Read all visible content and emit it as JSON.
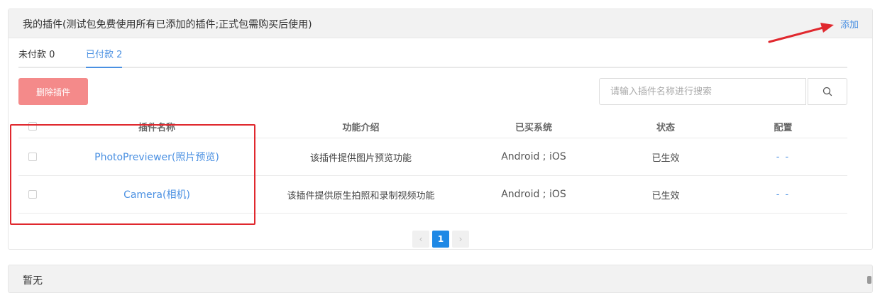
{
  "panel": {
    "title": "我的插件(测试包免费使用所有已添加的插件;正式包需购买后使用)",
    "add_label": "添加"
  },
  "tabs": {
    "unpaid": "未付款 0",
    "paid": "已付款 2"
  },
  "toolbar": {
    "delete_label": "删除插件",
    "search_placeholder": "请输入插件名称进行搜索"
  },
  "table": {
    "headers": {
      "name": "插件名称",
      "desc": "功能介绍",
      "system": "已买系统",
      "status": "状态",
      "config": "配置"
    },
    "rows": [
      {
        "name": "PhotoPreviewer(照片预览)",
        "desc": "该插件提供图片预览功能",
        "system": "Android ; iOS",
        "status": "已生效",
        "config": "- -"
      },
      {
        "name": "Camera(相机)",
        "desc": "该插件提供原生拍照和录制视频功能",
        "system": "Android ; iOS",
        "status": "已生效",
        "config": "- -"
      }
    ]
  },
  "pagination": {
    "prev": "‹",
    "current": "1",
    "next": "›"
  },
  "panel2": {
    "title": "暂无"
  },
  "colors": {
    "accent": "#4a90e2",
    "delete": "#f48a8a",
    "highlight": "#e0282e",
    "page_active": "#1e88e5"
  },
  "icons": {
    "search": "search-icon",
    "arrow": "red-arrow-annotation-icon"
  }
}
